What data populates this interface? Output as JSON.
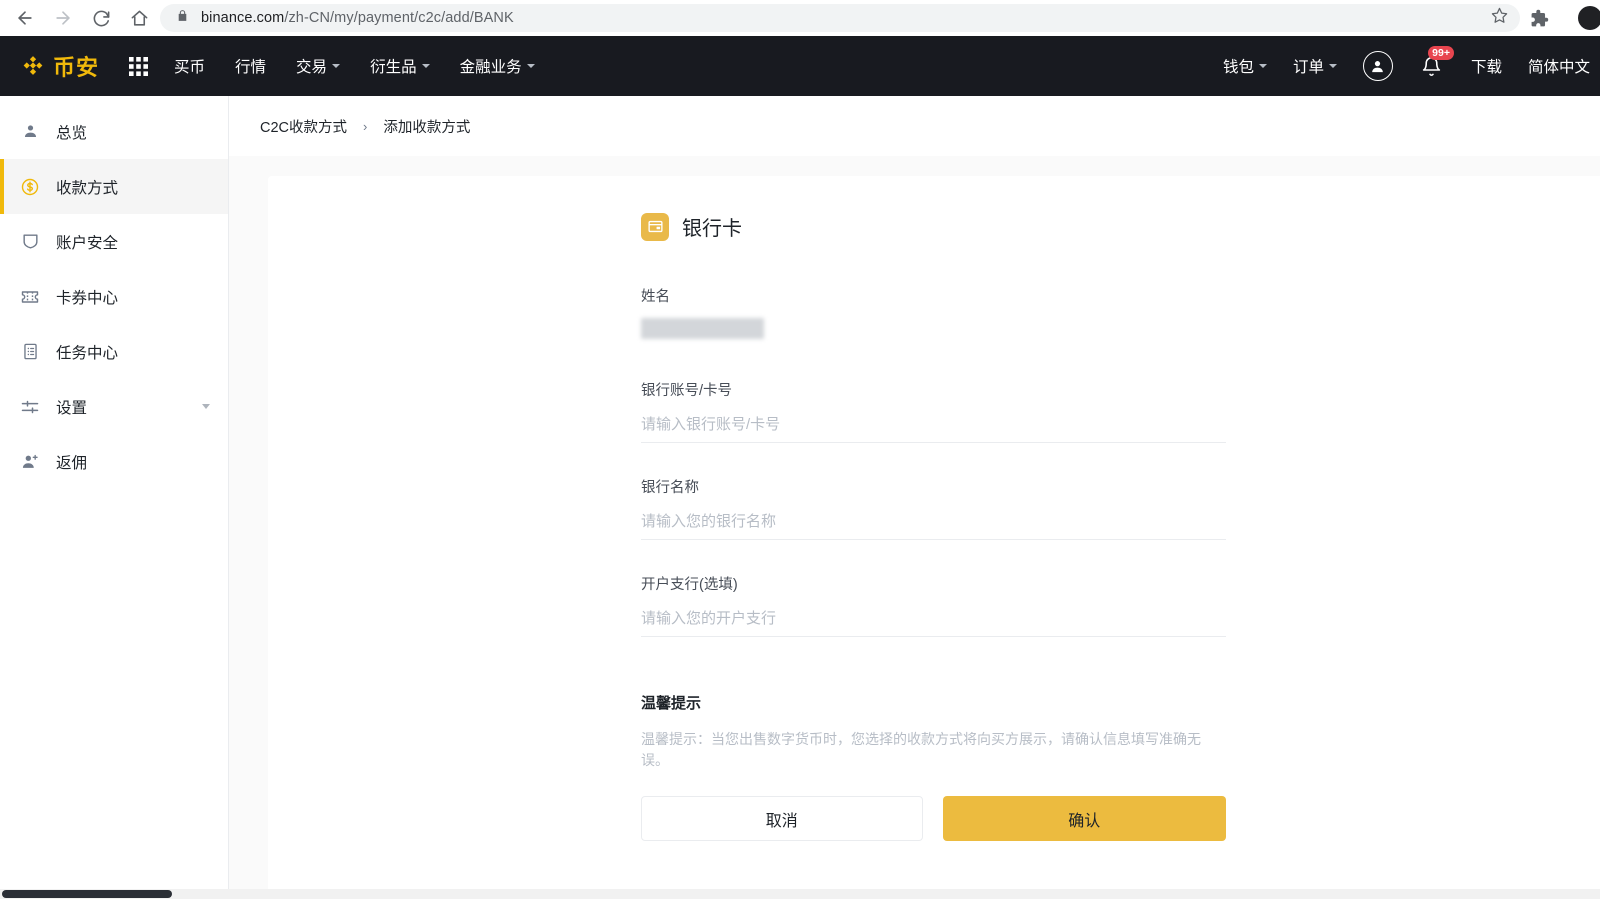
{
  "browser": {
    "back_icon": "back-arrow-icon",
    "forward_icon": "forward-arrow-icon",
    "reload_icon": "reload-icon",
    "home_icon": "home-icon",
    "lock_icon": "lock-icon",
    "url_secure": "binance.com",
    "url_path": "/zh-CN/my/payment/c2c/add/BANK",
    "url_full": "binance.com/zh-CN/my/payment/c2c/add/BANK",
    "star_icon": "bookmark-star-icon",
    "extensions_icon": "puzzle-extensions-icon",
    "profile_icon": "browser-profile-icon"
  },
  "topnav": {
    "logo_text": "币安",
    "logo_icon": "binance-diamond-logo",
    "apps_icon": "grid-apps-icon",
    "items": [
      {
        "label": "买币",
        "has_caret": false
      },
      {
        "label": "行情",
        "has_caret": false
      },
      {
        "label": "交易",
        "has_caret": true
      },
      {
        "label": "衍生品",
        "has_caret": true
      },
      {
        "label": "金融业务",
        "has_caret": true
      }
    ],
    "right": {
      "wallet": "钱包",
      "orders": "订单",
      "user_icon": "user-avatar-icon",
      "bell_icon": "notification-bell-icon",
      "badge": "99+",
      "download": "下载",
      "language": "简体中文"
    }
  },
  "sidebar": {
    "items": [
      {
        "label": "总览",
        "icon": "user-overview-icon",
        "active": false,
        "caret": false
      },
      {
        "label": "收款方式",
        "icon": "dollar-circle-icon",
        "active": true,
        "caret": false
      },
      {
        "label": "账户安全",
        "icon": "shield-icon",
        "active": false,
        "caret": false
      },
      {
        "label": "卡券中心",
        "icon": "ticket-icon",
        "active": false,
        "caret": false
      },
      {
        "label": "任务中心",
        "icon": "clipboard-tasks-icon",
        "active": false,
        "caret": false
      },
      {
        "label": "设置",
        "icon": "sliders-settings-icon",
        "active": false,
        "caret": true
      },
      {
        "label": "返佣",
        "icon": "user-add-referral-icon",
        "active": false,
        "caret": false
      }
    ]
  },
  "breadcrumb": {
    "parent": "C2C收款方式",
    "separator": "›",
    "current": "添加收款方式"
  },
  "form": {
    "icon": "bank-card-icon",
    "title": "银行卡",
    "fields": [
      {
        "label": "姓名",
        "type": "redacted",
        "value": "",
        "placeholder": ""
      },
      {
        "label": "银行账号/卡号",
        "type": "input",
        "value": "",
        "placeholder": "请输入银行账号/卡号"
      },
      {
        "label": "银行名称",
        "type": "input",
        "value": "",
        "placeholder": "请输入您的银行名称"
      },
      {
        "label": "开户支行(选填)",
        "type": "input",
        "value": "",
        "placeholder": "请输入您的开户支行"
      }
    ],
    "tips_title": "温馨提示",
    "tips_text": "温馨提示：当您出售数字货币时，您选择的收款方式将向买方展示，请确认信息填写准确无误。",
    "cancel_label": "取消",
    "confirm_label": "确认"
  },
  "colors": {
    "brand_yellow": "#f0b90b",
    "confirm_yellow": "#ecbb3f",
    "nav_dark": "#181a20",
    "badge_red": "#e8454f",
    "page_bg": "#fafafa"
  }
}
